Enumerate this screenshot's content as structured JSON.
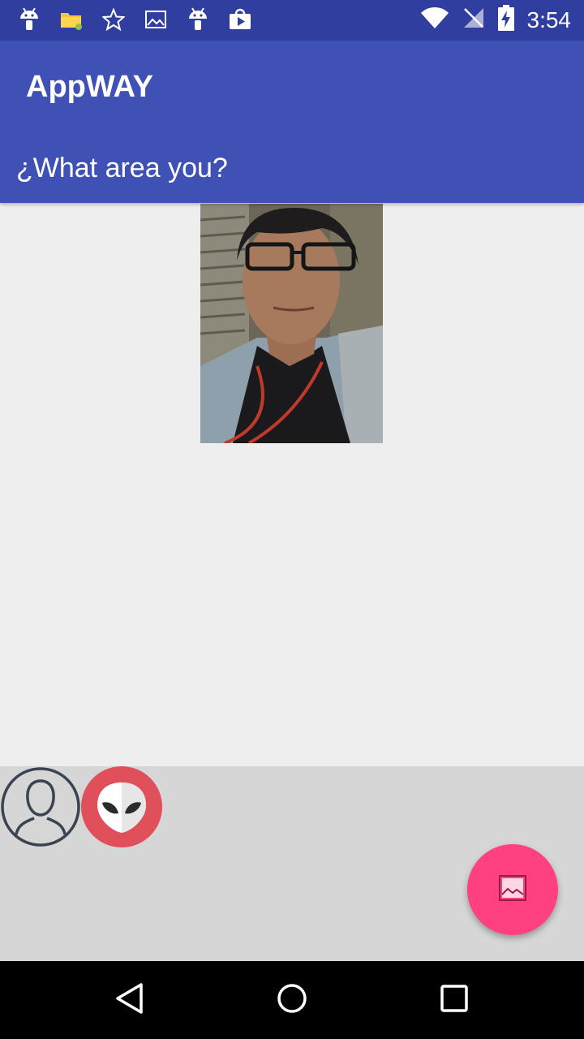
{
  "status_bar": {
    "time": "3:54",
    "left_icons": [
      "android-icon",
      "folder-icon",
      "star-icon",
      "image-icon",
      "android-icon",
      "play-store-icon"
    ],
    "right_icons": [
      "wifi-icon",
      "no-signal-icon",
      "battery-charging-icon"
    ]
  },
  "app_bar": {
    "title": "AppWAY",
    "subtitle": "¿What area you?"
  },
  "bottom_panel": {
    "avatar_icon": "person-outline-icon",
    "alien_icon": "alien-icon",
    "fab_icon": "image-icon"
  },
  "nav_bar": {
    "icons": [
      "back-icon",
      "home-icon",
      "recents-icon"
    ]
  },
  "colors": {
    "status_bar": "#303f9f",
    "app_bar": "#3f51b5",
    "content_bg": "#eeeeee",
    "bottom_panel": "#d6d6d6",
    "fab": "#ff4081",
    "alien_button": "#e0505a"
  }
}
